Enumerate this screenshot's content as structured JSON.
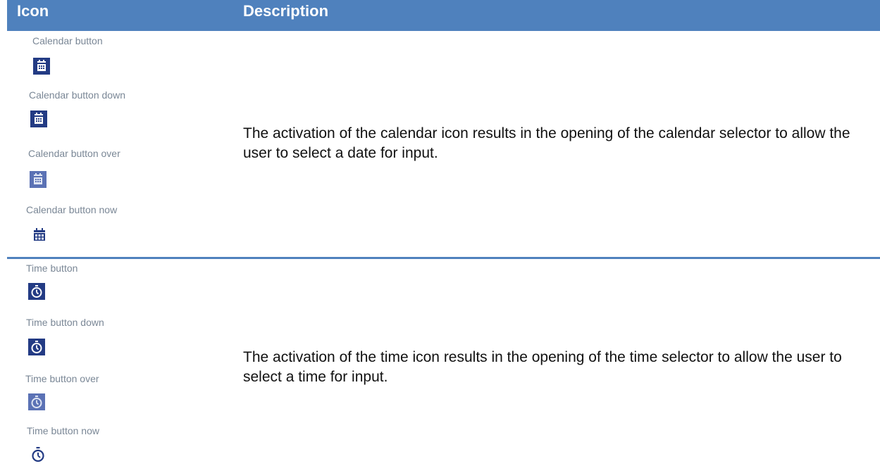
{
  "header": {
    "icon_col": "Icon",
    "desc_col": "Description"
  },
  "colors": {
    "header_bg": "#4f81bd",
    "button_fill": "#233b84",
    "button_over_fill": "#5b72b5",
    "icon_now": "#233b84"
  },
  "rows": [
    {
      "description": "The activation of the calendar icon results in the opening of the calendar selector to allow the user to select a date for input.",
      "states": [
        {
          "label": "Calendar button",
          "icon": "calendar-icon",
          "state": "default"
        },
        {
          "label": "Calendar button down",
          "icon": "calendar-icon",
          "state": "down"
        },
        {
          "label": "Calendar button over",
          "icon": "calendar-icon",
          "state": "over"
        },
        {
          "label": "Calendar button now",
          "icon": "calendar-icon",
          "state": "now"
        }
      ]
    },
    {
      "description": "The activation of the time icon results in the opening of the time selector to allow the user to select a time for input.",
      "states": [
        {
          "label": "Time button",
          "icon": "stopwatch-icon",
          "state": "default"
        },
        {
          "label": "Time button down",
          "icon": "stopwatch-icon",
          "state": "down"
        },
        {
          "label": "Time button over",
          "icon": "stopwatch-icon",
          "state": "over"
        },
        {
          "label": "Time button now",
          "icon": "stopwatch-icon",
          "state": "now"
        }
      ]
    }
  ]
}
